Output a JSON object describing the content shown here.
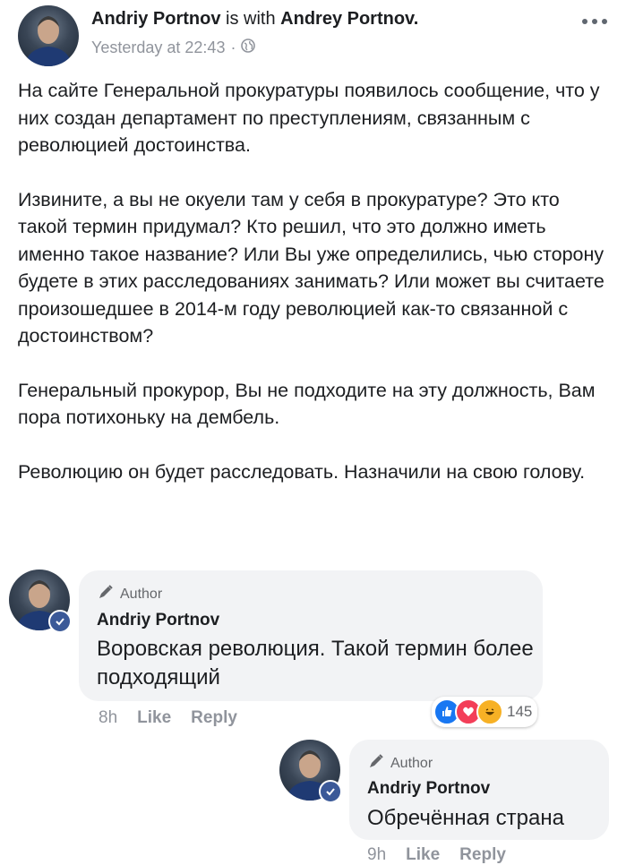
{
  "post": {
    "author": "Andriy Portnov",
    "with_text": "is with",
    "tagged": "Andrey Portnov.",
    "timestamp": "Yesterday at 22:43",
    "separator": "·",
    "paragraphs": [
      "На сайте Генеральной прокуратуры появилось сообщение, что у них создан департамент по преступлениям, связанным с революцией достоинства.",
      "Извините, а вы не окуели там у себя в прокуратуре? Это кто такой термин придумал? Кто решил, что это должно иметь именно такое название? Или Вы уже определились, чью сторону будете в этих расследованиях занимать? Или может вы считаете произошедшее в 2014-м году революцией как-то связанной с достоинством?",
      "Генеральный прокурор, Вы не подходите на эту должность, Вам пора потихоньку на дембель.",
      "Революцию он будет расследовать. Назначили на свою голову."
    ]
  },
  "comments": [
    {
      "author_tag": "Author",
      "name": "Andriy Portnov",
      "text": "Воровская революция. Такой термин более подходящий",
      "time": "8h",
      "like": "Like",
      "reply": "Reply",
      "reaction_count": "145"
    },
    {
      "author_tag": "Author",
      "name": "Andriy Portnov",
      "text": "Обречённая страна",
      "time": "9h",
      "like": "Like",
      "reply": "Reply"
    }
  ],
  "icons": {
    "globe": "globe-icon",
    "more": "more-options-icon",
    "pencil": "pencil-icon",
    "verified": "verified-badge-icon",
    "like": "like-reaction-icon",
    "love": "love-reaction-icon",
    "haha": "haha-reaction-icon"
  },
  "colors": {
    "text": "#1c1e21",
    "muted": "#90949c",
    "bubble": "#f2f3f5",
    "like_blue": "#1877f2",
    "love_red": "#f33e58",
    "haha_yellow": "#f7b125"
  }
}
